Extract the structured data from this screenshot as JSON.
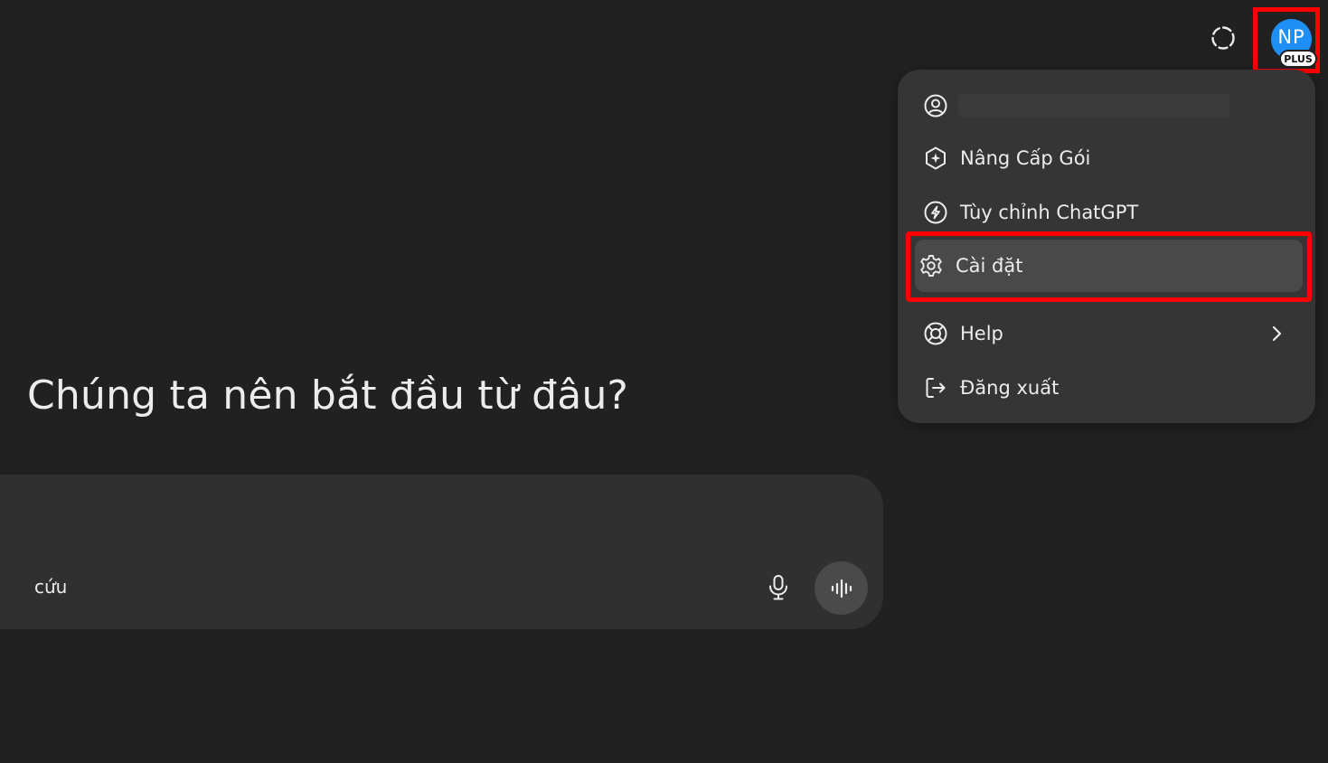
{
  "header": {
    "avatar_initials": "NP",
    "plan_badge": "PLUS"
  },
  "menu": {
    "items": [
      {
        "name": "account",
        "label": "",
        "icon": "user-circle-icon"
      },
      {
        "name": "upgrade",
        "label": "Nâng Cấp Gói",
        "icon": "sparkle-hexagon-icon"
      },
      {
        "name": "customize",
        "label": "Tùy chỉnh ChatGPT",
        "icon": "customize-icon"
      },
      {
        "name": "settings",
        "label": "Cài đặt",
        "icon": "gear-icon",
        "highlighted": true
      },
      {
        "name": "help",
        "label": "Help",
        "icon": "lifebuoy-icon",
        "has_submenu": true
      },
      {
        "name": "logout",
        "label": "Đăng xuất",
        "icon": "logout-icon"
      }
    ]
  },
  "main": {
    "heading": "Chúng ta nên bắt đầu từ đâu?"
  },
  "composer": {
    "tool_label_partial": "cứu"
  },
  "colors": {
    "background": "#212121",
    "menu_bg": "#353535",
    "menu_highlight": "#494949",
    "avatar": "#1e90f5",
    "annotation_red": "#ff0000"
  }
}
